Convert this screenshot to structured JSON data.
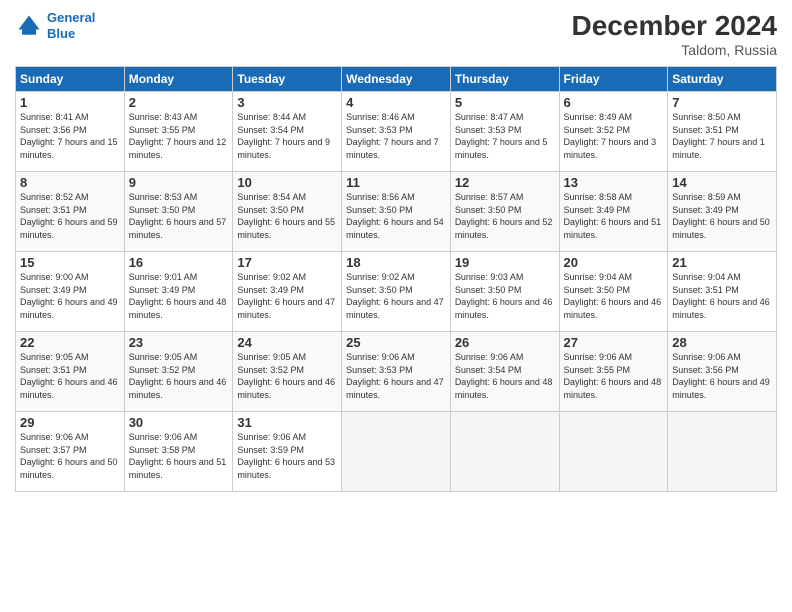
{
  "header": {
    "logo_line1": "General",
    "logo_line2": "Blue",
    "month": "December 2024",
    "location": "Taldom, Russia"
  },
  "days_of_week": [
    "Sunday",
    "Monday",
    "Tuesday",
    "Wednesday",
    "Thursday",
    "Friday",
    "Saturday"
  ],
  "weeks": [
    [
      {
        "num": "1",
        "sunrise": "8:41 AM",
        "sunset": "3:56 PM",
        "daylight": "7 hours and 15 minutes."
      },
      {
        "num": "2",
        "sunrise": "8:43 AM",
        "sunset": "3:55 PM",
        "daylight": "7 hours and 12 minutes."
      },
      {
        "num": "3",
        "sunrise": "8:44 AM",
        "sunset": "3:54 PM",
        "daylight": "7 hours and 9 minutes."
      },
      {
        "num": "4",
        "sunrise": "8:46 AM",
        "sunset": "3:53 PM",
        "daylight": "7 hours and 7 minutes."
      },
      {
        "num": "5",
        "sunrise": "8:47 AM",
        "sunset": "3:53 PM",
        "daylight": "7 hours and 5 minutes."
      },
      {
        "num": "6",
        "sunrise": "8:49 AM",
        "sunset": "3:52 PM",
        "daylight": "7 hours and 3 minutes."
      },
      {
        "num": "7",
        "sunrise": "8:50 AM",
        "sunset": "3:51 PM",
        "daylight": "7 hours and 1 minute."
      }
    ],
    [
      {
        "num": "8",
        "sunrise": "8:52 AM",
        "sunset": "3:51 PM",
        "daylight": "6 hours and 59 minutes."
      },
      {
        "num": "9",
        "sunrise": "8:53 AM",
        "sunset": "3:50 PM",
        "daylight": "6 hours and 57 minutes."
      },
      {
        "num": "10",
        "sunrise": "8:54 AM",
        "sunset": "3:50 PM",
        "daylight": "6 hours and 55 minutes."
      },
      {
        "num": "11",
        "sunrise": "8:56 AM",
        "sunset": "3:50 PM",
        "daylight": "6 hours and 54 minutes."
      },
      {
        "num": "12",
        "sunrise": "8:57 AM",
        "sunset": "3:50 PM",
        "daylight": "6 hours and 52 minutes."
      },
      {
        "num": "13",
        "sunrise": "8:58 AM",
        "sunset": "3:49 PM",
        "daylight": "6 hours and 51 minutes."
      },
      {
        "num": "14",
        "sunrise": "8:59 AM",
        "sunset": "3:49 PM",
        "daylight": "6 hours and 50 minutes."
      }
    ],
    [
      {
        "num": "15",
        "sunrise": "9:00 AM",
        "sunset": "3:49 PM",
        "daylight": "6 hours and 49 minutes."
      },
      {
        "num": "16",
        "sunrise": "9:01 AM",
        "sunset": "3:49 PM",
        "daylight": "6 hours and 48 minutes."
      },
      {
        "num": "17",
        "sunrise": "9:02 AM",
        "sunset": "3:49 PM",
        "daylight": "6 hours and 47 minutes."
      },
      {
        "num": "18",
        "sunrise": "9:02 AM",
        "sunset": "3:50 PM",
        "daylight": "6 hours and 47 minutes."
      },
      {
        "num": "19",
        "sunrise": "9:03 AM",
        "sunset": "3:50 PM",
        "daylight": "6 hours and 46 minutes."
      },
      {
        "num": "20",
        "sunrise": "9:04 AM",
        "sunset": "3:50 PM",
        "daylight": "6 hours and 46 minutes."
      },
      {
        "num": "21",
        "sunrise": "9:04 AM",
        "sunset": "3:51 PM",
        "daylight": "6 hours and 46 minutes."
      }
    ],
    [
      {
        "num": "22",
        "sunrise": "9:05 AM",
        "sunset": "3:51 PM",
        "daylight": "6 hours and 46 minutes."
      },
      {
        "num": "23",
        "sunrise": "9:05 AM",
        "sunset": "3:52 PM",
        "daylight": "6 hours and 46 minutes."
      },
      {
        "num": "24",
        "sunrise": "9:05 AM",
        "sunset": "3:52 PM",
        "daylight": "6 hours and 46 minutes."
      },
      {
        "num": "25",
        "sunrise": "9:06 AM",
        "sunset": "3:53 PM",
        "daylight": "6 hours and 47 minutes."
      },
      {
        "num": "26",
        "sunrise": "9:06 AM",
        "sunset": "3:54 PM",
        "daylight": "6 hours and 48 minutes."
      },
      {
        "num": "27",
        "sunrise": "9:06 AM",
        "sunset": "3:55 PM",
        "daylight": "6 hours and 48 minutes."
      },
      {
        "num": "28",
        "sunrise": "9:06 AM",
        "sunset": "3:56 PM",
        "daylight": "6 hours and 49 minutes."
      }
    ],
    [
      {
        "num": "29",
        "sunrise": "9:06 AM",
        "sunset": "3:57 PM",
        "daylight": "6 hours and 50 minutes."
      },
      {
        "num": "30",
        "sunrise": "9:06 AM",
        "sunset": "3:58 PM",
        "daylight": "6 hours and 51 minutes."
      },
      {
        "num": "31",
        "sunrise": "9:06 AM",
        "sunset": "3:59 PM",
        "daylight": "6 hours and 53 minutes."
      },
      null,
      null,
      null,
      null
    ]
  ]
}
